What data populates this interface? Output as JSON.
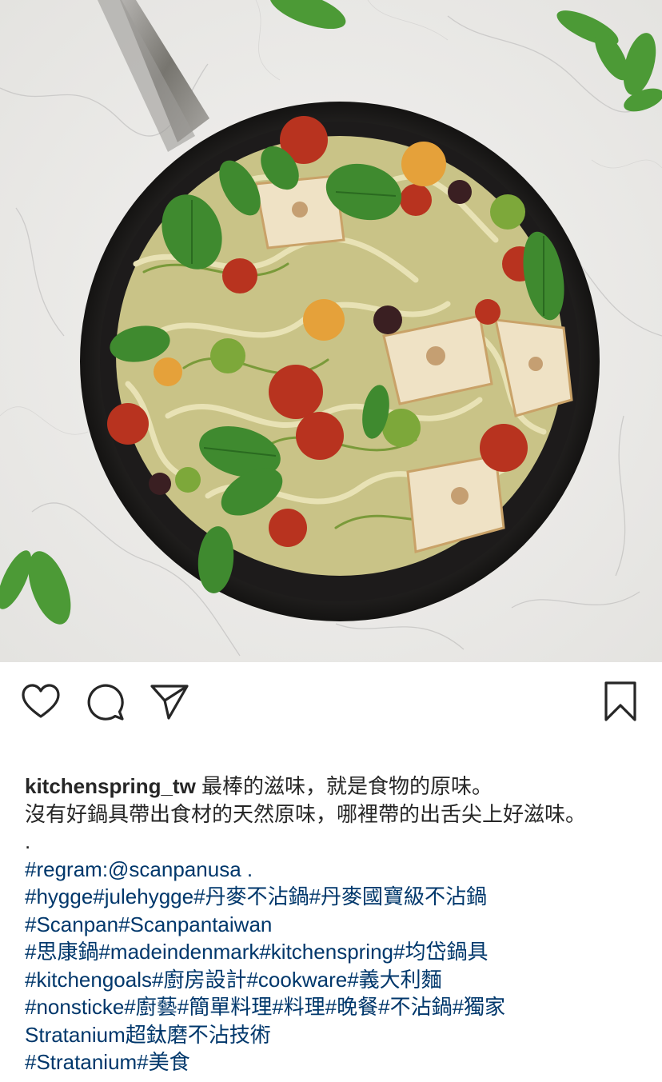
{
  "post": {
    "image": {
      "icon": "food-photo",
      "marble_color": "#ecebe9",
      "pan_color": "#1f1d1d",
      "handle_color": "#8c8b88"
    },
    "actions": {
      "like_icon": "heart-icon",
      "comment_icon": "comment-icon",
      "share_icon": "paper-plane-icon",
      "save_icon": "bookmark-icon"
    },
    "caption": {
      "username": "kitchenspring_tw",
      "line1_text": " 最棒的滋味，就是食物的原味。",
      "line2": "沒有好鍋具帶出食材的天然原味，哪裡帶的出舌尖上好滋味。",
      "line3": ".",
      "line4": "#regram:@scanpanusa .",
      "line5": "#hygge#julehygge#丹麥不沾鍋#丹麥國寶級不沾鍋",
      "line6": "#Scanpan#Scanpantaiwan",
      "line7": "#思康鍋#madeindenmark#kitchenspring#均岱鍋具",
      "line8": "#kitchengoals#廚房設計#cookware#義大利麵",
      "line9": "#nonsticke#廚藝#簡單料理#料理#晚餐#不沾鍋#獨家",
      "line10": "Stratanium超鈦磨不沾技術",
      "line11": "#Stratanium#美食"
    },
    "colors": {
      "text": "#262626",
      "hashtag": "#00376b",
      "icon": "#262626"
    }
  }
}
